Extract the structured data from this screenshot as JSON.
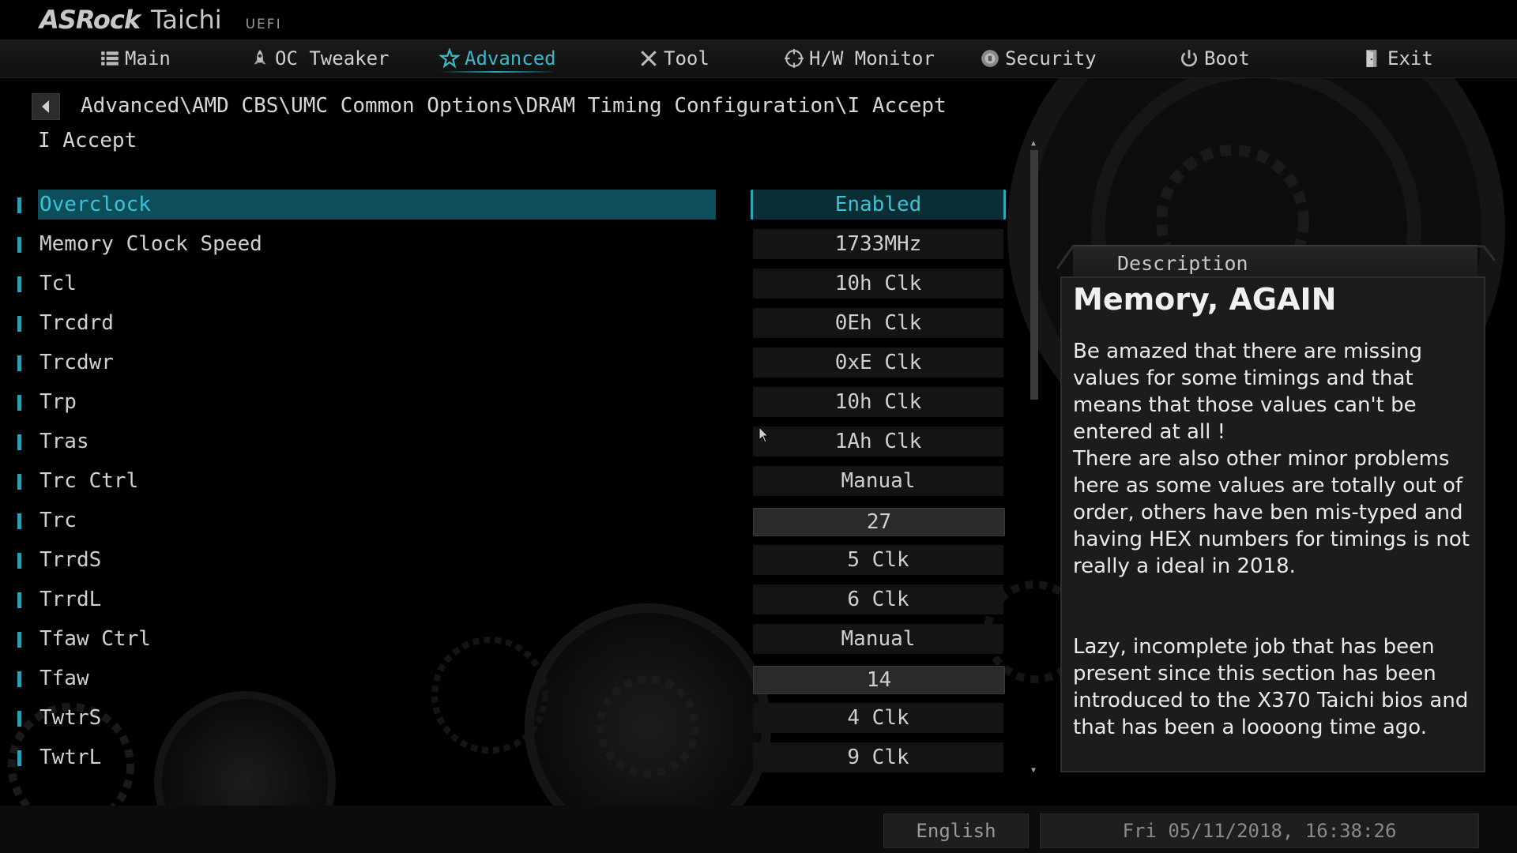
{
  "header": {
    "brand": "ASRock",
    "model": "Taichi",
    "uefi": "UEFI"
  },
  "nav": [
    {
      "label": "Main",
      "icon": "list-icon",
      "active": false
    },
    {
      "label": "OC Tweaker",
      "icon": "rocket-icon",
      "active": false
    },
    {
      "label": "Advanced",
      "icon": "star-icon",
      "active": true
    },
    {
      "label": "Tool",
      "icon": "tools-icon",
      "active": false
    },
    {
      "label": "H/W Monitor",
      "icon": "monitor-target-icon",
      "active": false
    },
    {
      "label": "Security",
      "icon": "shield-icon",
      "active": false
    },
    {
      "label": "Boot",
      "icon": "power-icon",
      "active": false
    },
    {
      "label": "Exit",
      "icon": "exit-door-icon",
      "active": false
    }
  ],
  "breadcrumb": "Advanced\\AMD CBS\\UMC Common Options\\DRAM Timing Configuration\\I Accept",
  "subtitle": "I Accept",
  "settings": [
    {
      "label": "Overclock",
      "value": "Enabled",
      "selected": true
    },
    {
      "label": "Memory Clock Speed",
      "value": "1733MHz"
    },
    {
      "label": "Tcl",
      "value": "10h Clk"
    },
    {
      "label": "Trcdrd",
      "value": "0Eh Clk"
    },
    {
      "label": "Trcdwr",
      "value": "0xE Clk"
    },
    {
      "label": "Trp",
      "value": "10h Clk"
    },
    {
      "label": "Tras",
      "value": "1Ah Clk"
    },
    {
      "label": "Trc Ctrl",
      "value": "Manual"
    },
    {
      "label": "Trc",
      "value": "27",
      "input": true
    },
    {
      "label": "TrrdS",
      "value": "5 Clk"
    },
    {
      "label": "TrrdL",
      "value": "6 Clk"
    },
    {
      "label": "Tfaw Ctrl",
      "value": "Manual"
    },
    {
      "label": "Tfaw",
      "value": "14",
      "input": true
    },
    {
      "label": "TwtrS",
      "value": "4 Clk"
    },
    {
      "label": "TwtrL",
      "value": "9 Clk"
    }
  ],
  "description": {
    "header": "Description",
    "title": "Memory, AGAIN",
    "text": "Be amazed that there are missing values for some timings and that means that those values can't be entered at all !\nThere are also other minor problems here as some values are totally out of order, others have ben mis-typed and having HEX numbers for timings is not really a ideal in 2018.\n\n\nLazy, incomplete job that has been present since this section has been introduced to the X370 Taichi bios and that has been a loooong time ago."
  },
  "footer": {
    "language": "English",
    "datetime": "Fri 05/11/2018, 16:38:26"
  },
  "colors": {
    "accent": "#2aa8ba",
    "selected_row": "#0c4f5b",
    "background": "#000000"
  }
}
